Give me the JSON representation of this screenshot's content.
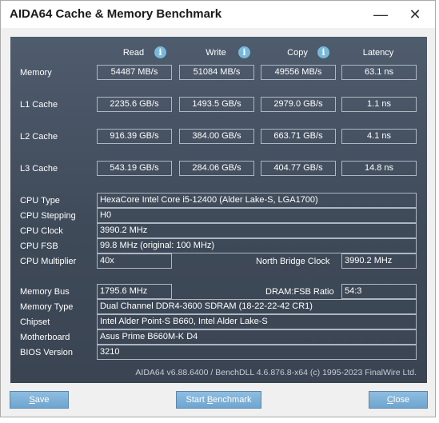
{
  "window": {
    "title": "AIDA64 Cache & Memory Benchmark",
    "minimize_glyph": "—",
    "close_glyph": "✕"
  },
  "columns": {
    "read": "Read",
    "write": "Write",
    "copy": "Copy",
    "latency": "Latency",
    "info_glyph": "i"
  },
  "rows": [
    {
      "label": "Memory",
      "read": "54487 MB/s",
      "write": "51084 MB/s",
      "copy": "49556 MB/s",
      "latency": "63.1 ns"
    },
    {
      "label": "L1 Cache",
      "read": "2235.6 GB/s",
      "write": "1493.5 GB/s",
      "copy": "2979.0 GB/s",
      "latency": "1.1 ns"
    },
    {
      "label": "L2 Cache",
      "read": "916.39 GB/s",
      "write": "384.00 GB/s",
      "copy": "663.71 GB/s",
      "latency": "4.1 ns"
    },
    {
      "label": "L3 Cache",
      "read": "543.19 GB/s",
      "write": "284.06 GB/s",
      "copy": "404.77 GB/s",
      "latency": "14.8 ns"
    }
  ],
  "cpu": {
    "type_label": "CPU Type",
    "type_value": "HexaCore Intel Core i5-12400  (Alder Lake-S, LGA1700)",
    "stepping_label": "CPU Stepping",
    "stepping_value": "H0",
    "clock_label": "CPU Clock",
    "clock_value": "3990.2 MHz",
    "fsb_label": "CPU FSB",
    "fsb_value": "99.8 MHz  (original: 100 MHz)",
    "multiplier_label": "CPU Multiplier",
    "multiplier_value": "40x",
    "nb_clock_label": "North Bridge Clock",
    "nb_clock_value": "3990.2 MHz"
  },
  "memory": {
    "bus_label": "Memory Bus",
    "bus_value": "1795.6 MHz",
    "ratio_label": "DRAM:FSB Ratio",
    "ratio_value": "54:3",
    "type_label": "Memory Type",
    "type_value": "Dual Channel DDR4-3600 SDRAM  (18-22-22-42 CR1)",
    "chipset_label": "Chipset",
    "chipset_value": "Intel Alder Point-S B660, Intel Alder Lake-S",
    "motherboard_label": "Motherboard",
    "motherboard_value": "Asus Prime B660M-K D4",
    "bios_label": "BIOS Version",
    "bios_value": "3210"
  },
  "footer": {
    "copyright": "AIDA64 v6.88.6400 / BenchDLL 4.6.876.8-x64  (c) 1995-2023 FinalWire Ltd."
  },
  "buttons": {
    "save_first": "S",
    "save_rest": "ave",
    "start_pre": "Start ",
    "start_first": "B",
    "start_rest": "enchmark",
    "close_first": "C",
    "close_rest": "lose"
  }
}
